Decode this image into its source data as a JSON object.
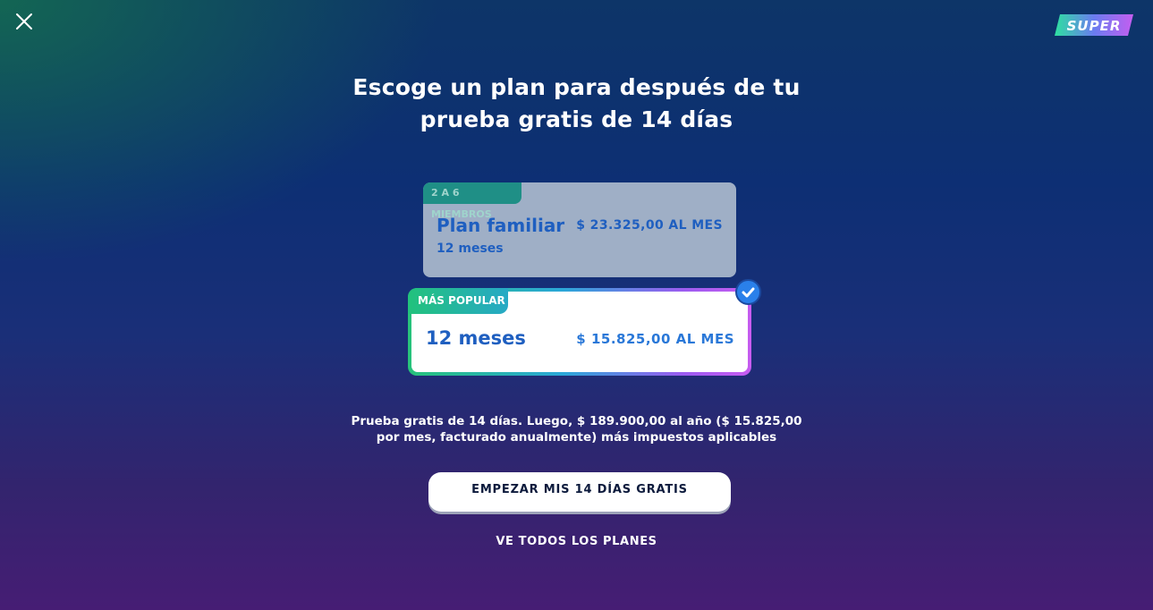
{
  "header": {
    "logo_text": "SUPER"
  },
  "headline": {
    "line1": "Escoge un plan para después de tu",
    "line2": "prueba gratis de 14 días"
  },
  "plans": [
    {
      "badge": "2 A 6 MIEMBROS",
      "name": "Plan familiar",
      "duration": "12 meses",
      "price": "$ 23.325,00 AL MES",
      "selected": false
    },
    {
      "badge": "MÁS POPULAR",
      "name": "12 meses",
      "price": "$ 15.825,00 AL MES",
      "selected": true
    }
  ],
  "terms": {
    "line1": "Prueba gratis de 14 días. Luego, $ 189.900,00 al año ($ 15.825,00",
    "line2": "por mes, facturado anualmente) más impuestos aplicables"
  },
  "actions": {
    "start_trial_label": "EMPEZAR MIS 14 DÍAS GRATIS",
    "see_all_label": "VE TODOS LOS PLANES"
  },
  "colors": {
    "accent_blue": "#1f5fc0",
    "badge_green": "#22c27c",
    "logo_purple": "#c45ef0"
  },
  "icons": {
    "close": "close-icon",
    "selected": "checkmark-icon"
  }
}
